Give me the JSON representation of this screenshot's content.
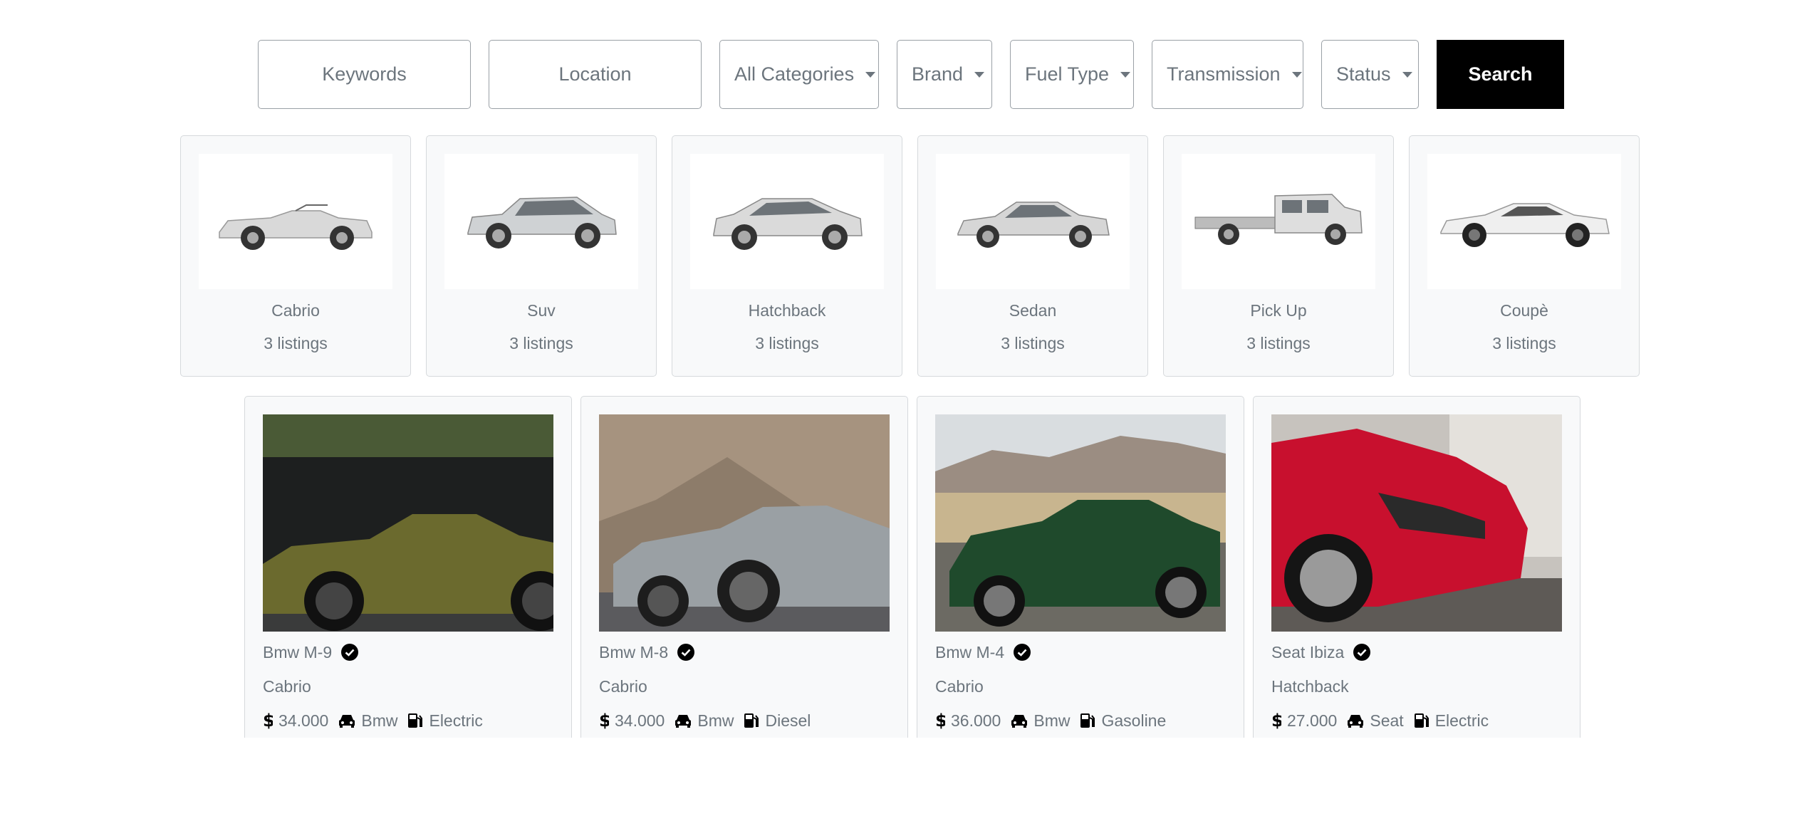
{
  "search": {
    "keywords_placeholder": "Keywords",
    "location_placeholder": "Location",
    "categories_label": "All Categories",
    "brand_label": "Brand",
    "fuel_label": "Fuel Type",
    "transmission_label": "Transmission",
    "status_label": "Status",
    "button_label": "Search"
  },
  "categories": [
    {
      "name": "Cabrio",
      "count": "3 listings",
      "icon": "car-cabrio-image"
    },
    {
      "name": "Suv",
      "count": "3 listings",
      "icon": "car-suv-image"
    },
    {
      "name": "Hatchback",
      "count": "3 listings",
      "icon": "car-hatchback-image"
    },
    {
      "name": "Sedan",
      "count": "3 listings",
      "icon": "car-sedan-image"
    },
    {
      "name": "Pick Up",
      "count": "3 listings",
      "icon": "car-pickup-image"
    },
    {
      "name": "Coupè",
      "count": "3 listings",
      "icon": "car-coupe-image"
    }
  ],
  "listings": [
    {
      "title": "Bmw M-9",
      "category": "Cabrio",
      "price": "34.000",
      "brand": "Bmw",
      "fuel": "Electric",
      "body_color": "#6b6a2e"
    },
    {
      "title": "Bmw M-8",
      "category": "Cabrio",
      "price": "34.000",
      "brand": "Bmw",
      "fuel": "Diesel",
      "body_color": "#9aa0a4"
    },
    {
      "title": "Bmw M-4",
      "category": "Cabrio",
      "price": "36.000",
      "brand": "Bmw",
      "fuel": "Gasoline",
      "body_color": "#1f4a2c"
    },
    {
      "title": "Seat Ibiza",
      "category": "Hatchback",
      "price": "27.000",
      "brand": "Seat",
      "fuel": "Electric",
      "body_color": "#c8102e"
    }
  ],
  "colors": {
    "accent": "#000000",
    "text_muted": "#6c757d",
    "card_bg": "#f8f9fa",
    "border": "#d6d9dc"
  }
}
